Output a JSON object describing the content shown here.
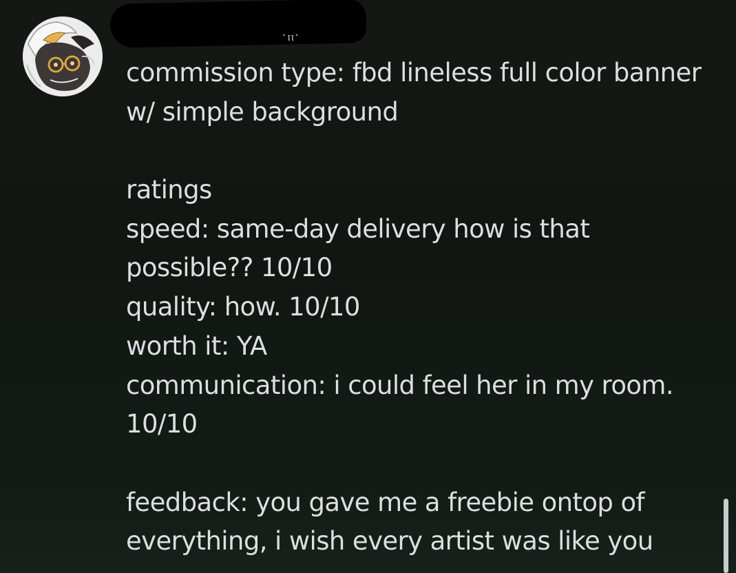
{
  "message": {
    "author_fragment": "ˑⲡˑ",
    "lines": {
      "l0": "commission type: fbd lineless full color banner",
      "l1": "w/ simple background",
      "l2": "ratings",
      "l3": "speed: same-day delivery how is that",
      "l4": "possible?? 10/10",
      "l5": "quality: how. 10/10",
      "l6": "worth it: YA",
      "l7": "communication: i could feel her in my room.",
      "l8": "10/10",
      "l9": "feedback: you gave me a freebie ontop of",
      "l10": "everything, i wish every artist was like you"
    }
  },
  "colors": {
    "background": "#131814",
    "text": "#dcdfe1",
    "redaction": "#000000",
    "scrollbar": "#c9cccf"
  }
}
